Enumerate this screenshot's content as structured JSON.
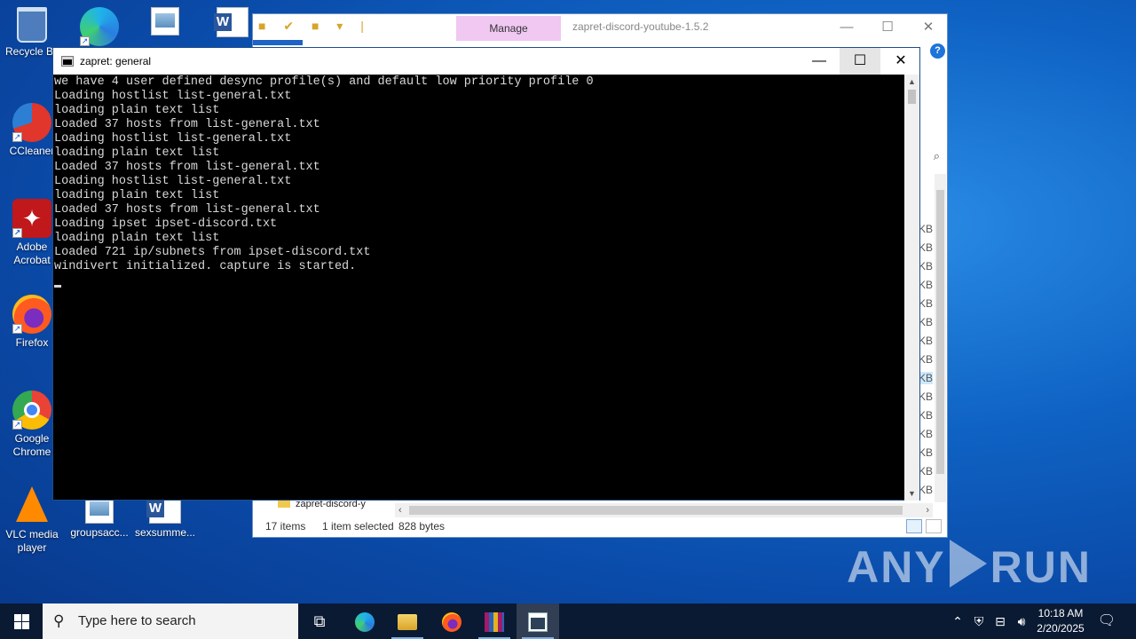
{
  "desktop": {
    "icons": [
      {
        "label": "Recycle Bin"
      },
      {
        "label": "CCleaner"
      },
      {
        "label": "Adobe Acrobat"
      },
      {
        "label": "Firefox"
      },
      {
        "label": "Google Chrome"
      },
      {
        "label": "VLC media player"
      },
      {
        "label": "groupsacc..."
      },
      {
        "label": "sexsumme..."
      }
    ]
  },
  "explorer": {
    "manage_tab": "Manage",
    "title": "zapret-discord-youtube-1.5.2",
    "minimize": "—",
    "maximize": "☐",
    "close": "✕",
    "help": "?",
    "size_units": [
      "KB",
      "KB",
      "KB",
      "KB",
      "KB",
      "KB",
      "KB",
      "KB",
      "KB",
      "KB",
      "KB",
      "KB",
      "KB",
      "KB",
      "KB"
    ],
    "tree_item": "zapret-discord-y",
    "status": {
      "items": "17 items",
      "selected": "1 item selected",
      "size": "828 bytes"
    }
  },
  "console": {
    "title": "zapret: general",
    "minimize": "—",
    "maximize": "☐",
    "close": "✕",
    "lines": [
      "we have 4 user defined desync profile(s) and default low priority profile 0",
      "Loading hostlist list-general.txt",
      "loading plain text list",
      "Loaded 37 hosts from list-general.txt",
      "Loading hostlist list-general.txt",
      "loading plain text list",
      "Loaded 37 hosts from list-general.txt",
      "Loading hostlist list-general.txt",
      "loading plain text list",
      "Loaded 37 hosts from list-general.txt",
      "Loading ipset ipset-discord.txt",
      "loading plain text list",
      "Loaded 721 ip/subnets from ipset-discord.txt",
      "windivert initialized. capture is started."
    ]
  },
  "watermark": {
    "left": "ANY",
    "right": "RUN"
  },
  "taskbar": {
    "search_placeholder": "Type here to search",
    "clock_time": "10:18 AM",
    "clock_date": "2/20/2025"
  }
}
